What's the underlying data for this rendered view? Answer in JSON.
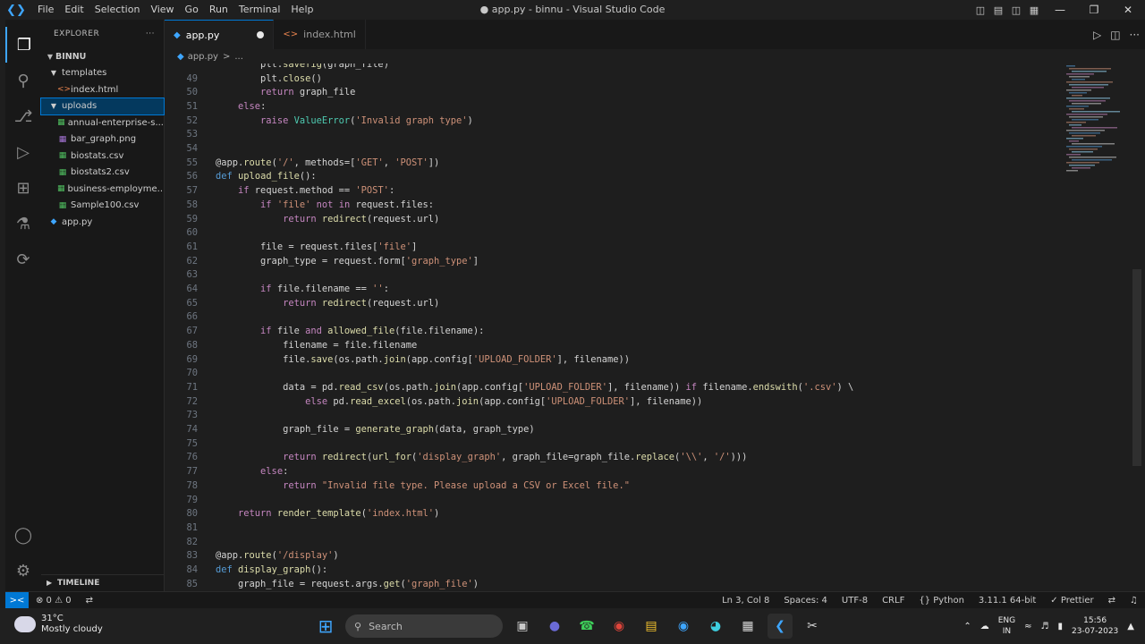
{
  "window": {
    "title": "● app.py - binnu - Visual Studio Code",
    "menu": [
      "File",
      "Edit",
      "Selection",
      "View",
      "Go",
      "Run",
      "Terminal",
      "Help"
    ]
  },
  "activity_bar": {
    "items": [
      "explorer-icon",
      "search-icon",
      "source-control-icon",
      "run-debug-icon",
      "extensions-icon",
      "testing-icon",
      "remote-explorer-icon"
    ],
    "bottom": [
      "accounts-icon",
      "manage-gear-icon"
    ]
  },
  "explorer": {
    "header": "EXPLORER",
    "more": "···",
    "root": "BINNU",
    "tree": [
      {
        "label": "templates",
        "type": "folder",
        "depth": 1
      },
      {
        "label": "index.html",
        "type": "html",
        "depth": 2
      },
      {
        "label": "uploads",
        "type": "folder",
        "depth": 1,
        "selected": true
      },
      {
        "label": "annual-enterprise-s...",
        "type": "csv",
        "depth": 2
      },
      {
        "label": "bar_graph.png",
        "type": "image",
        "depth": 2
      },
      {
        "label": "biostats.csv",
        "type": "csv",
        "depth": 2
      },
      {
        "label": "biostats2.csv",
        "type": "csv",
        "depth": 2
      },
      {
        "label": "business-employme...",
        "type": "csv",
        "depth": 2
      },
      {
        "label": "Sample100.csv",
        "type": "csv",
        "depth": 2
      },
      {
        "label": "app.py",
        "type": "python",
        "depth": 1
      }
    ],
    "timeline": "TIMELINE"
  },
  "tabs": [
    {
      "label": "app.py",
      "active": true,
      "modified": true
    },
    {
      "label": "index.html",
      "active": false
    }
  ],
  "breadcrumb": {
    "file": "app.py",
    "sep": ">",
    "more": "..."
  },
  "code_lines": [
    {
      "n": "",
      "t": "        plt.savefig(graph_file)"
    },
    {
      "n": "49",
      "t": "        plt.close()"
    },
    {
      "n": "50",
      "t": "        return graph_file"
    },
    {
      "n": "51",
      "t": "    else:"
    },
    {
      "n": "52",
      "t": "        raise ValueError('Invalid graph type')"
    },
    {
      "n": "53",
      "t": ""
    },
    {
      "n": "54",
      "t": ""
    },
    {
      "n": "55",
      "t": "@app.route('/', methods=['GET', 'POST'])"
    },
    {
      "n": "56",
      "t": "def upload_file():"
    },
    {
      "n": "57",
      "t": "    if request.method == 'POST':"
    },
    {
      "n": "58",
      "t": "        if 'file' not in request.files:"
    },
    {
      "n": "59",
      "t": "            return redirect(request.url)"
    },
    {
      "n": "60",
      "t": ""
    },
    {
      "n": "61",
      "t": "        file = request.files['file']"
    },
    {
      "n": "62",
      "t": "        graph_type = request.form['graph_type']"
    },
    {
      "n": "63",
      "t": ""
    },
    {
      "n": "64",
      "t": "        if file.filename == '':"
    },
    {
      "n": "65",
      "t": "            return redirect(request.url)"
    },
    {
      "n": "66",
      "t": ""
    },
    {
      "n": "67",
      "t": "        if file and allowed_file(file.filename):"
    },
    {
      "n": "68",
      "t": "            filename = file.filename"
    },
    {
      "n": "69",
      "t": "            file.save(os.path.join(app.config['UPLOAD_FOLDER'], filename))"
    },
    {
      "n": "70",
      "t": ""
    },
    {
      "n": "71",
      "t": "            data = pd.read_csv(os.path.join(app.config['UPLOAD_FOLDER'], filename)) if filename.endswith('.csv') \\"
    },
    {
      "n": "72",
      "t": "                else pd.read_excel(os.path.join(app.config['UPLOAD_FOLDER'], filename))"
    },
    {
      "n": "73",
      "t": ""
    },
    {
      "n": "74",
      "t": "            graph_file = generate_graph(data, graph_type)"
    },
    {
      "n": "75",
      "t": ""
    },
    {
      "n": "76",
      "t": "            return redirect(url_for('display_graph', graph_file=graph_file.replace('\\\\', '/')))"
    },
    {
      "n": "77",
      "t": "        else:"
    },
    {
      "n": "78",
      "t": "            return \"Invalid file type. Please upload a CSV or Excel file.\""
    },
    {
      "n": "79",
      "t": ""
    },
    {
      "n": "80",
      "t": "    return render_template('index.html')"
    },
    {
      "n": "81",
      "t": ""
    },
    {
      "n": "82",
      "t": ""
    },
    {
      "n": "83",
      "t": "@app.route('/display')"
    },
    {
      "n": "84",
      "t": "def display_graph():"
    },
    {
      "n": "85",
      "t": "    graph_file = request.args.get('graph_file')"
    }
  ],
  "status_bar": {
    "remote": "><",
    "problems": "⊗ 0 ⚠ 0",
    "ports": "⇄",
    "position": "Ln 3, Col 8",
    "spaces": "Spaces: 4",
    "encoding": "UTF-8",
    "eol": "CRLF",
    "language": "{} Python",
    "interpreter": "3.11.1 64-bit",
    "formatter": "✓ Prettier"
  },
  "taskbar": {
    "weather_temp": "31°C",
    "weather_desc": "Mostly cloudy",
    "search_placeholder": "Search",
    "lang_line1": "ENG",
    "lang_line2": "IN",
    "time": "15:56",
    "date": "23-07-2023"
  },
  "colors": {
    "accent": "#0078d4",
    "editor_bg": "#1e1e1e",
    "chrome_bg": "#181818"
  }
}
